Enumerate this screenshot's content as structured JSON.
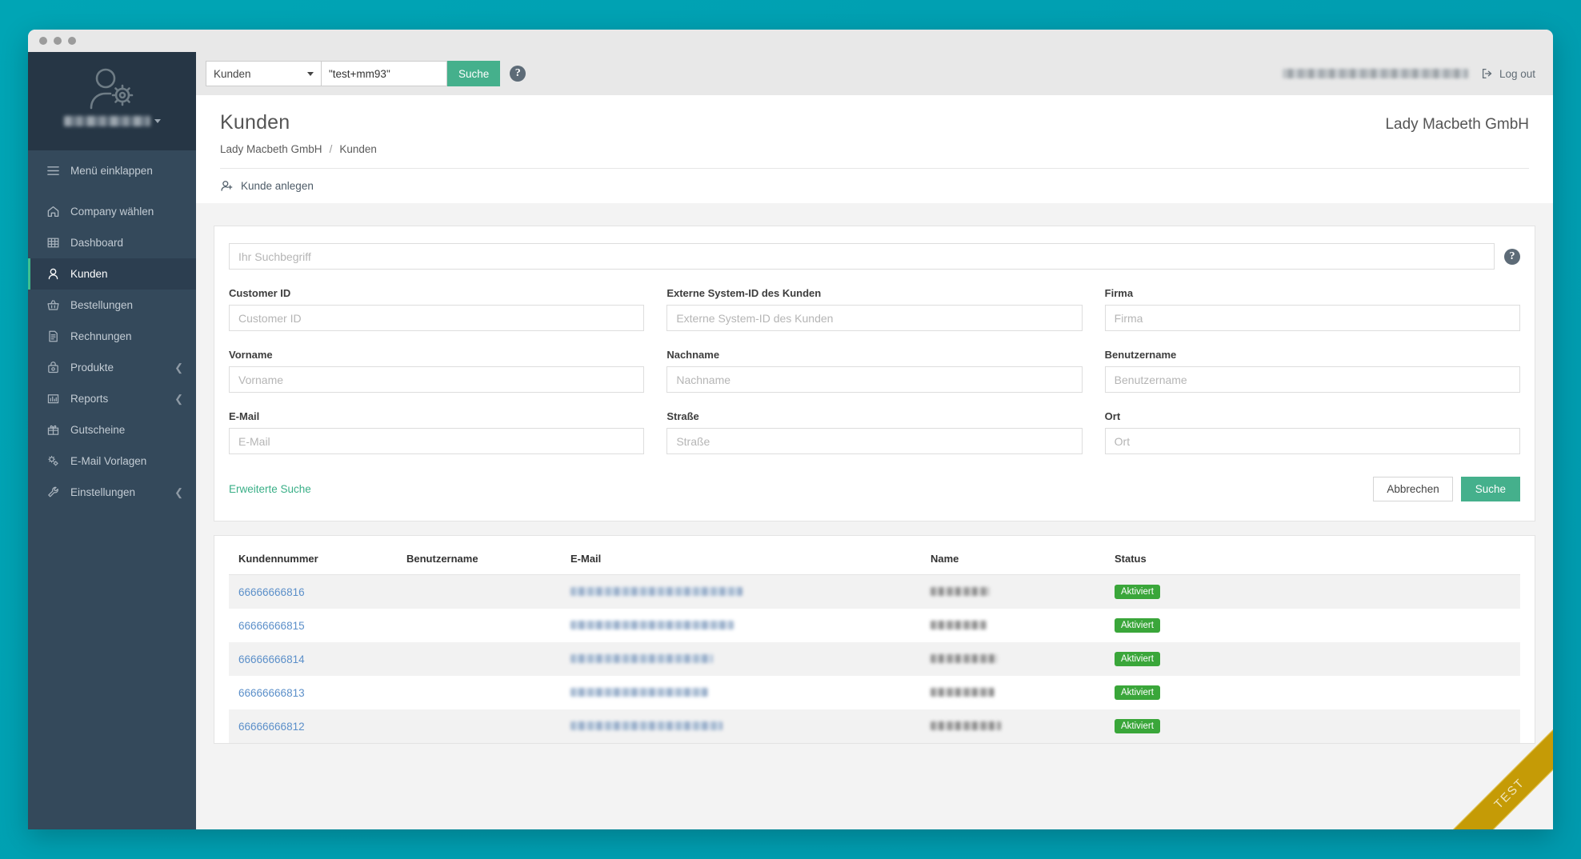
{
  "window": {
    "dots": 3
  },
  "topbar": {
    "scope_select": "Kunden",
    "search_value": "\"test+mm93\"",
    "search_button": "Suche",
    "help_icon": "question-mark-circle-icon",
    "account_text": "",
    "logout_label": "Log out"
  },
  "sidebar": {
    "avatar_icon": "user-gear-icon",
    "user_name": "",
    "items": [
      {
        "label": "Menü einklappen",
        "icon": "hamburger-icon",
        "active": false,
        "chevron": false
      },
      {
        "label": "Company wählen",
        "icon": "home-icon",
        "active": false,
        "chevron": false
      },
      {
        "label": "Dashboard",
        "icon": "grid-icon",
        "active": false,
        "chevron": false
      },
      {
        "label": "Kunden",
        "icon": "user-icon",
        "active": true,
        "chevron": false
      },
      {
        "label": "Bestellungen",
        "icon": "basket-icon",
        "active": false,
        "chevron": false
      },
      {
        "label": "Rechnungen",
        "icon": "document-icon",
        "active": false,
        "chevron": false
      },
      {
        "label": "Produkte",
        "icon": "bag-icon",
        "active": false,
        "chevron": true
      },
      {
        "label": "Reports",
        "icon": "bar-chart-icon",
        "active": false,
        "chevron": true
      },
      {
        "label": "Gutscheine",
        "icon": "gift-icon",
        "active": false,
        "chevron": false
      },
      {
        "label": "E-Mail Vorlagen",
        "icon": "gears-icon",
        "active": false,
        "chevron": false
      },
      {
        "label": "Einstellungen",
        "icon": "wrench-icon",
        "active": false,
        "chevron": true
      }
    ]
  },
  "page": {
    "title": "Kunden",
    "company": "Lady Macbeth GmbH",
    "breadcrumb": {
      "root": "Lady Macbeth GmbH",
      "separator": "/",
      "current": "Kunden"
    },
    "action": {
      "label": "Kunde anlegen",
      "icon": "user-plus-icon"
    }
  },
  "search_form": {
    "main_placeholder": "Ihr Suchbegriff",
    "main_value": "",
    "help_icon": "question-mark-circle-icon",
    "fields": [
      {
        "label": "Customer ID",
        "placeholder": "Customer ID",
        "value": ""
      },
      {
        "label": "Externe System-ID des Kunden",
        "placeholder": "Externe System-ID des Kunden",
        "value": ""
      },
      {
        "label": "Firma",
        "placeholder": "Firma",
        "value": ""
      },
      {
        "label": "Vorname",
        "placeholder": "Vorname",
        "value": ""
      },
      {
        "label": "Nachname",
        "placeholder": "Nachname",
        "value": ""
      },
      {
        "label": "Benutzername",
        "placeholder": "Benutzername",
        "value": ""
      },
      {
        "label": "E-Mail",
        "placeholder": "E-Mail",
        "value": ""
      },
      {
        "label": "Straße",
        "placeholder": "Straße",
        "value": ""
      },
      {
        "label": "Ort",
        "placeholder": "Ort",
        "value": ""
      }
    ],
    "advanced_link": "Erweiterte Suche",
    "cancel_button": "Abbrechen",
    "submit_button": "Suche"
  },
  "table": {
    "columns": [
      "Kundennummer",
      "Benutzername",
      "E-Mail",
      "Name",
      "Status"
    ],
    "rows": [
      {
        "kundennummer": "66666666816",
        "benutzername": "",
        "email": "",
        "name": "",
        "status": "Aktiviert"
      },
      {
        "kundennummer": "66666666815",
        "benutzername": "",
        "email": "",
        "name": "",
        "status": "Aktiviert"
      },
      {
        "kundennummer": "66666666814",
        "benutzername": "",
        "email": "",
        "name": "",
        "status": "Aktiviert"
      },
      {
        "kundennummer": "66666666813",
        "benutzername": "",
        "email": "",
        "name": "",
        "status": "Aktiviert"
      },
      {
        "kundennummer": "66666666812",
        "benutzername": "",
        "email": "",
        "name": "",
        "status": "Aktiviert"
      }
    ]
  },
  "ribbon": {
    "label": "TEST"
  },
  "colors": {
    "desktop": "#00a0b2",
    "sidebar": "#34495b",
    "sidebar_head": "#263645",
    "accent_green": "#45b08c",
    "active_marker": "#3fbf8f",
    "link_blue": "#5b8fc9",
    "badge_green": "#3aa63a",
    "ribbon_gold": "#c59b06"
  }
}
